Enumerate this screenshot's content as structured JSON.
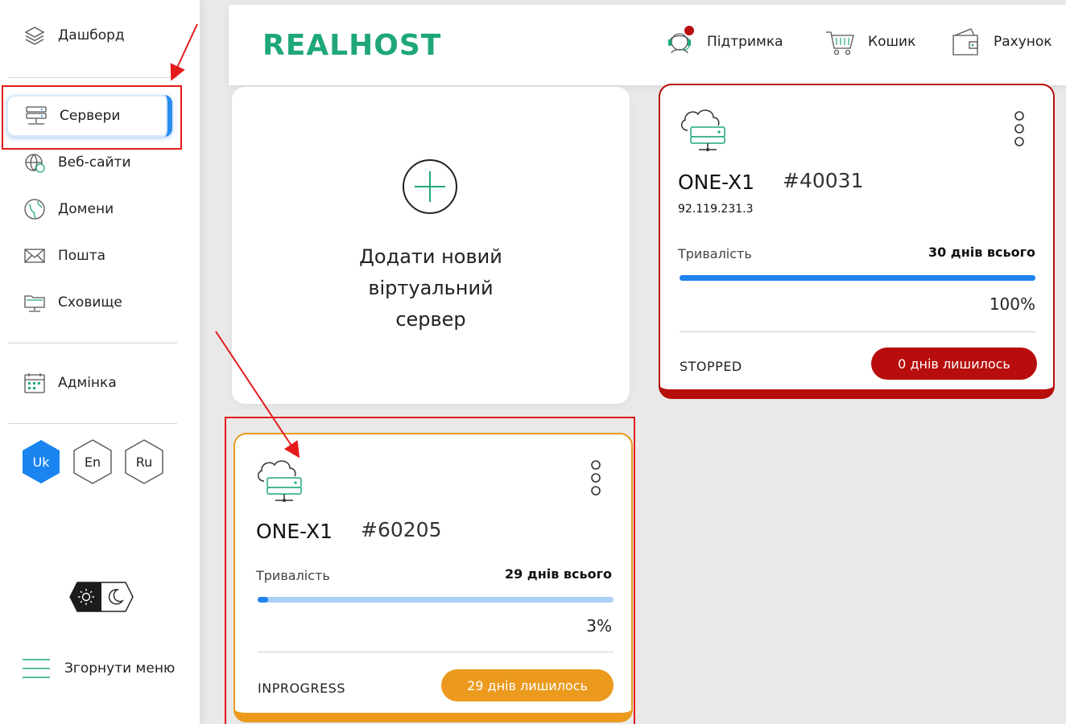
{
  "sidebar": {
    "items": [
      {
        "label": "Дашборд",
        "icon": "layers-icon"
      },
      {
        "label": "Сервери",
        "icon": "server-icon"
      },
      {
        "label": "Веб-сайти",
        "icon": "websites-icon"
      },
      {
        "label": "Домени",
        "icon": "globe-icon"
      },
      {
        "label": "Пошта",
        "icon": "mail-icon"
      },
      {
        "label": "Сховище",
        "icon": "storage-icon"
      },
      {
        "label": "Адмінка",
        "icon": "calendar-icon"
      }
    ],
    "languages": [
      {
        "code": "Uk",
        "active": true
      },
      {
        "code": "En",
        "active": false
      },
      {
        "code": "Ru",
        "active": false
      }
    ],
    "collapse_label": "Згорнути меню",
    "accent": "#2a8cf0"
  },
  "header": {
    "logo": "REALHOST",
    "support": "Підтримка",
    "cart": "Кошик",
    "account": "Рахунок"
  },
  "add_card": {
    "label": "Додати новий віртуальний сервер"
  },
  "servers": [
    {
      "name": "ONE-X1",
      "id": "#40031",
      "ip": "92.119.231.3",
      "duration_label": "Тривалість",
      "duration_total": "30 днів всього",
      "progress": 1.0,
      "progress_text": "100%",
      "status": "STOPPED",
      "days_left": "0 днів лишилось",
      "color": "#b80d0d"
    },
    {
      "name": "ONE-X1",
      "id": "#60205",
      "duration_label": "Тривалість",
      "duration_total": "29 днів всього",
      "progress": 0.03,
      "progress_text": "3%",
      "status": "INPROGRESS",
      "days_left": "29 днів лишилось",
      "color": "#eb9a1e"
    }
  ]
}
